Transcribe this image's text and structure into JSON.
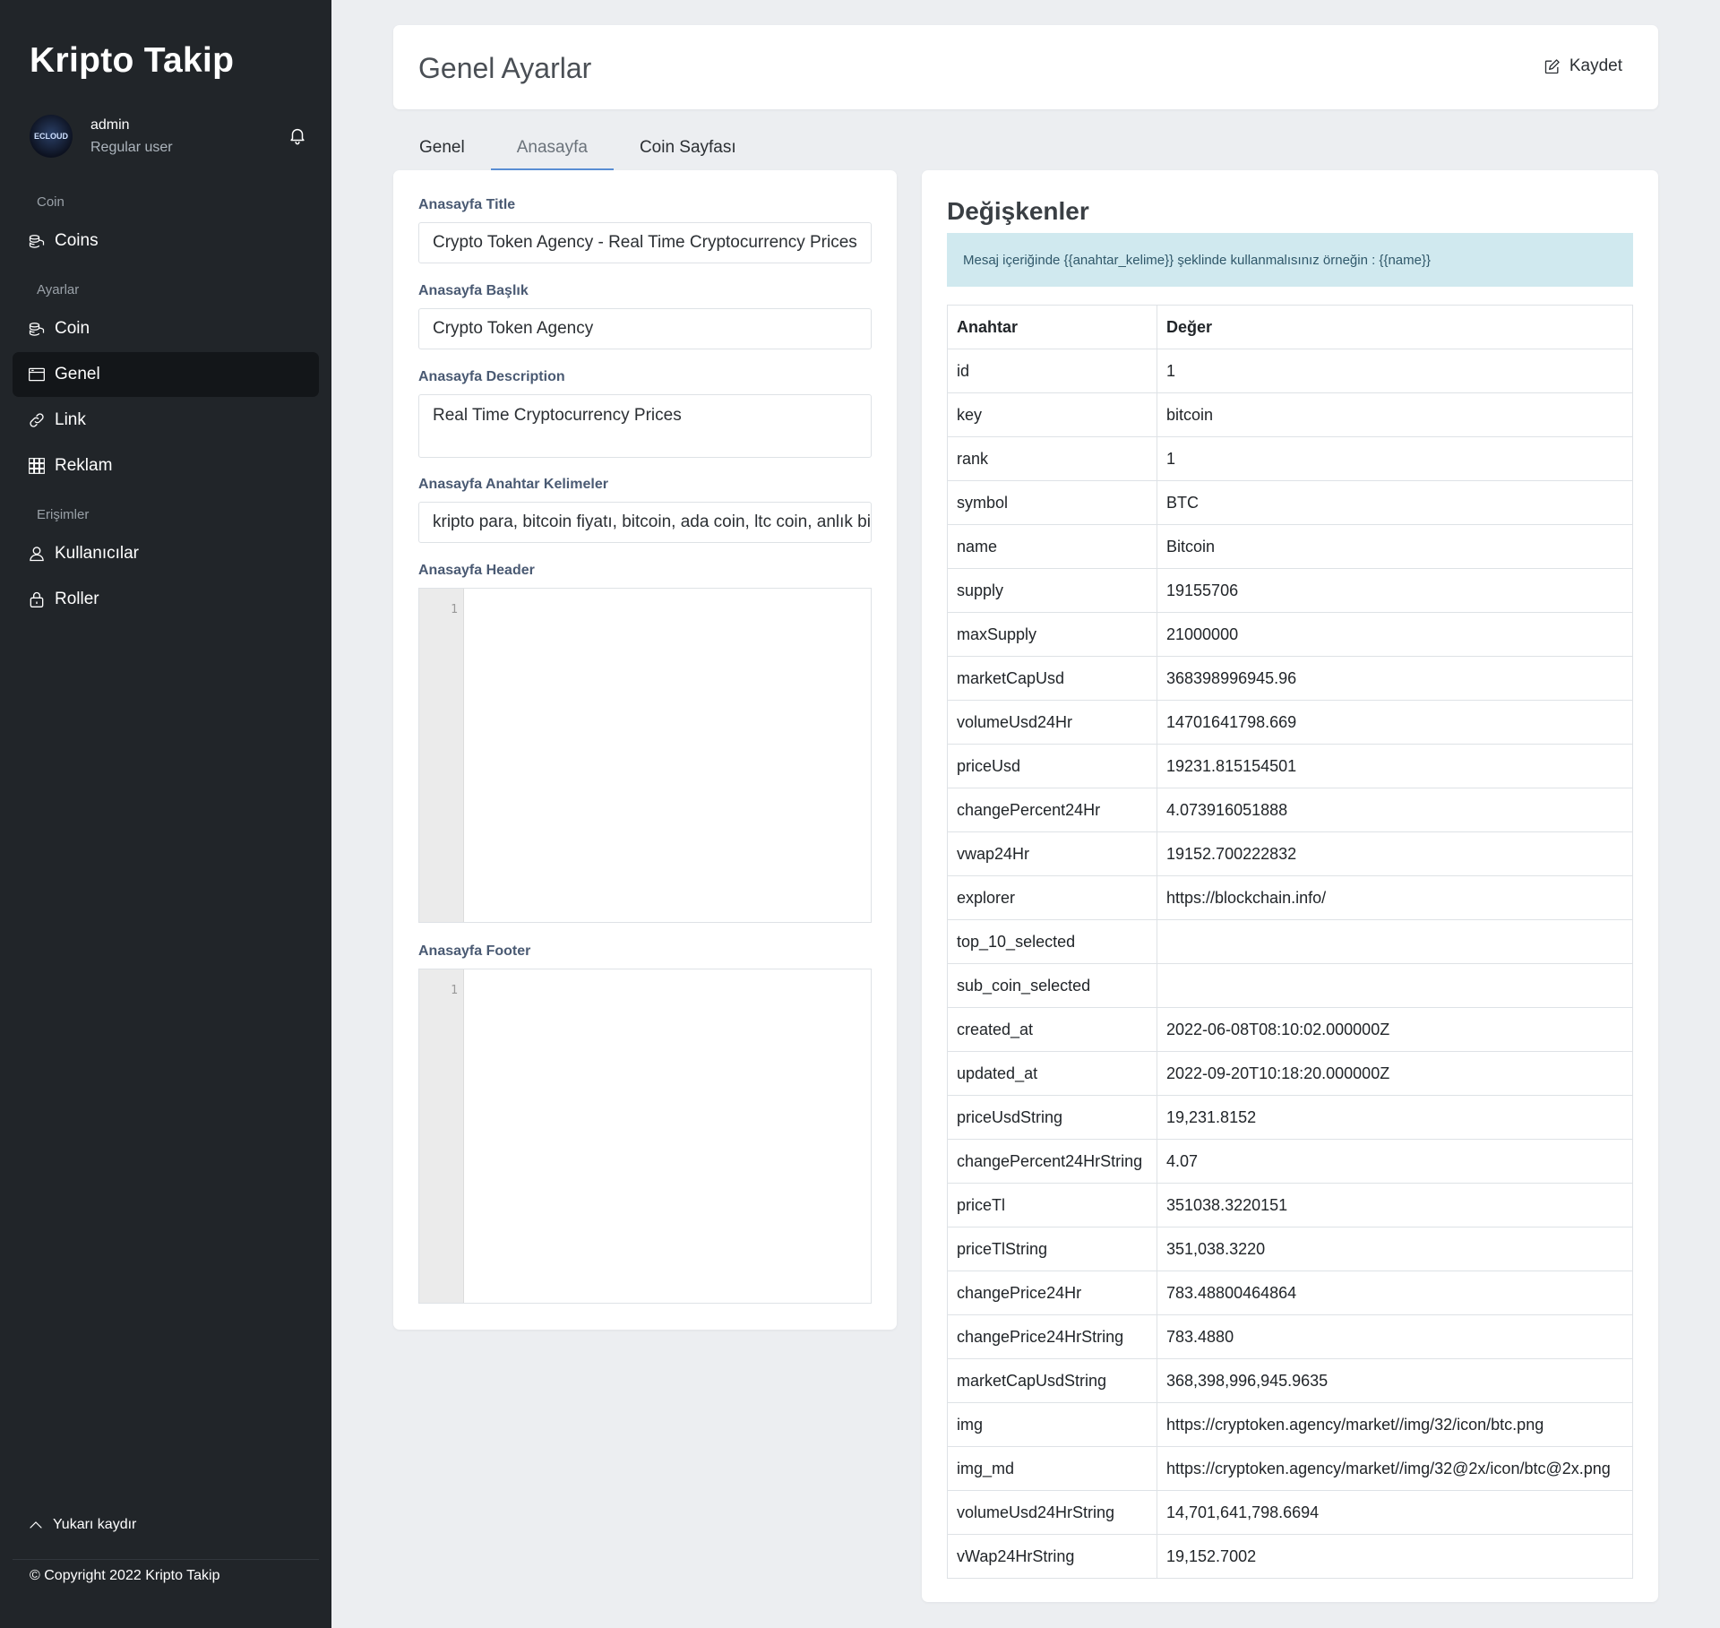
{
  "sidebar": {
    "brand": "Kripto Takip",
    "user": {
      "name": "admin",
      "role": "Regular user",
      "avatar_text": "ECLOUD"
    },
    "sections": [
      "Coin",
      "Ayarlar",
      "Erişimler"
    ],
    "items": [
      {
        "label": "Coins",
        "icon": "coins-icon"
      },
      {
        "label": "Coin",
        "icon": "coins-icon"
      },
      {
        "label": "Genel",
        "icon": "window-icon",
        "active": true
      },
      {
        "label": "Link",
        "icon": "link-icon"
      },
      {
        "label": "Reklam",
        "icon": "grid-icon"
      },
      {
        "label": "Kullanıcılar",
        "icon": "user-icon"
      },
      {
        "label": "Roller",
        "icon": "lock-icon"
      }
    ],
    "scroll_top": "Yukarı kaydır",
    "copyright_prefix": "© Copyright 2022",
    "copyright_brand": "Kripto Takip"
  },
  "header": {
    "title": "Genel Ayarlar",
    "save_label": "Kaydet"
  },
  "tabs": [
    "Genel",
    "Anasayfa",
    "Coin Sayfası"
  ],
  "active_tab": "Anasayfa",
  "form": {
    "title_label": "Anasayfa Title",
    "title_value": "Crypto Token Agency - Real Time Cryptocurrency Prices",
    "baslik_label": "Anasayfa Başlık",
    "baslik_value": "Crypto Token Agency",
    "description_label": "Anasayfa Description",
    "description_value": "Real Time Cryptocurrency Prices",
    "keywords_label": "Anasayfa Anahtar Kelimeler",
    "keywords_value": "kripto para, bitcoin fiyatı, bitcoin, ada coin, ltc coin, anlık bi",
    "header_label": "Anasayfa Header",
    "footer_label": "Anasayfa Footer",
    "line_number": "1"
  },
  "variables": {
    "title": "Değişkenler",
    "hint": "Mesaj içeriğinde {{anahtar_kelime}} şeklinde kullanmalısınız örneğin : {{name}}",
    "col_key": "Anahtar",
    "col_value": "Değer",
    "rows": [
      [
        "id",
        "1"
      ],
      [
        "key",
        "bitcoin"
      ],
      [
        "rank",
        "1"
      ],
      [
        "symbol",
        "BTC"
      ],
      [
        "name",
        "Bitcoin"
      ],
      [
        "supply",
        "19155706"
      ],
      [
        "maxSupply",
        "21000000"
      ],
      [
        "marketCapUsd",
        "368398996945.96"
      ],
      [
        "volumeUsd24Hr",
        "14701641798.669"
      ],
      [
        "priceUsd",
        "19231.815154501"
      ],
      [
        "changePercent24Hr",
        "4.073916051888"
      ],
      [
        "vwap24Hr",
        "19152.700222832"
      ],
      [
        "explorer",
        "https://blockchain.info/"
      ],
      [
        "top_10_selected",
        ""
      ],
      [
        "sub_coin_selected",
        ""
      ],
      [
        "created_at",
        "2022-06-08T08:10:02.000000Z"
      ],
      [
        "updated_at",
        "2022-09-20T10:18:20.000000Z"
      ],
      [
        "priceUsdString",
        "19,231.8152"
      ],
      [
        "changePercent24HrString",
        "4.07"
      ],
      [
        "priceTl",
        "351038.3220151"
      ],
      [
        "priceTlString",
        "351,038.3220"
      ],
      [
        "changePrice24Hr",
        "783.48800464864"
      ],
      [
        "changePrice24HrString",
        "783.4880"
      ],
      [
        "marketCapUsdString",
        "368,398,996,945.9635"
      ],
      [
        "img",
        "https://cryptoken.agency/market//img/32/icon/btc.png"
      ],
      [
        "img_md",
        "https://cryptoken.agency/market//img/32@2x/icon/btc@2x.png"
      ],
      [
        "volumeUsd24HrString",
        "14,701,641,798.6694"
      ],
      [
        "vWap24HrString",
        "19,152.7002"
      ]
    ]
  }
}
